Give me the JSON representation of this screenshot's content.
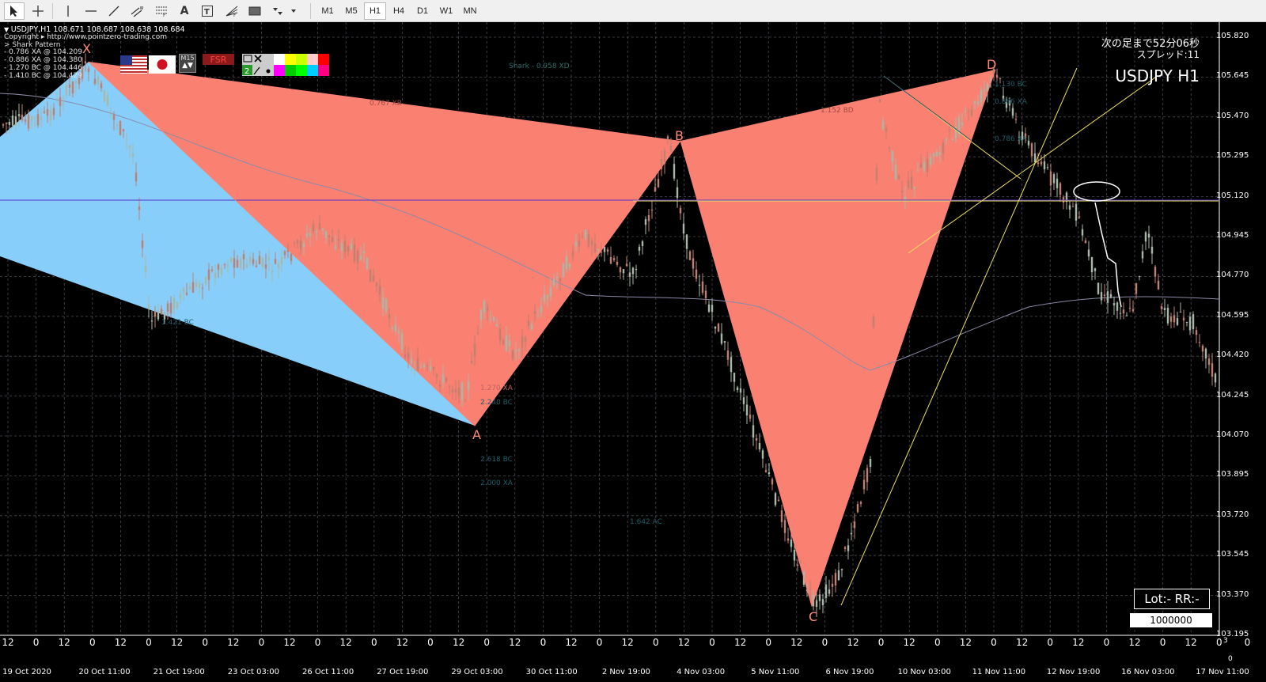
{
  "toolbar": {
    "tools": [
      "cursor-tool",
      "crosshair-tool",
      "vertical-line-tool",
      "horizontal-line-tool",
      "trendline-tool",
      "equidistant-channel-tool",
      "fibonacci-tool",
      "text-tool",
      "text-label-tool",
      "fibonacci-fan-tool",
      "rectangle-tool",
      "arrows-tool"
    ],
    "timeframes": [
      "M1",
      "M5",
      "H1",
      "H4",
      "D1",
      "W1",
      "MN"
    ],
    "active_timeframe": "H1"
  },
  "chart_header": {
    "symbol_line": "USDJPY,H1  108.671 108.687 108.638 108.684",
    "copyright": "Copyright ▸ http://www.pointzero-trading.com",
    "pattern_name": "> Shark Pattern",
    "levels": [
      "- 0.786 XA @ 104.209",
      "- 0.886 XA @ 104.380",
      "- 1.270 BC @ 104.446",
      "- 1.410 BC @ 104.429"
    ]
  },
  "top_right": {
    "next_bar": "次の足まで52分06秒",
    "spread": "スプレッド:11",
    "title": "USDJPY H1"
  },
  "panel": {
    "fsr_label": "FSR",
    "m_label": "M15",
    "two_label": "2"
  },
  "fib_labels": [
    {
      "text": "Shark - 0.958 XD"
    },
    {
      "text": "0.767 XB"
    },
    {
      "text": "1.152 BD"
    },
    {
      "text": "1.130 BC"
    },
    {
      "text": "0.886 XA"
    },
    {
      "text": "0.786 XA"
    },
    {
      "text": "1.421 BC"
    },
    {
      "text": "1.270 XA"
    },
    {
      "text": "2.240 BC"
    },
    {
      "text": "2.618 BC"
    },
    {
      "text": "2.000 XA"
    },
    {
      "text": "1.642 AC"
    }
  ],
  "points": {
    "X": "X",
    "A": "A",
    "B": "B",
    "C": "C",
    "D": "D"
  },
  "lot": {
    "label": "Lot:- RR:-",
    "value": "1000000"
  },
  "y_axis": [
    "105.820",
    "105.645",
    "105.470",
    "105.295",
    "105.120",
    "104.945",
    "104.770",
    "104.595",
    "104.420",
    "104.245",
    "104.070",
    "103.895",
    "103.720",
    "103.545",
    "103.370",
    "103.195"
  ],
  "x_axis_top": [
    "12",
    "0",
    "12",
    "0",
    "12",
    "0",
    "12",
    "0",
    "12",
    "0",
    "12",
    "0",
    "12",
    "0",
    "12",
    "0",
    "12",
    "0",
    "12",
    "0",
    "12",
    "0",
    "12",
    "0",
    "12",
    "0",
    "12",
    "0",
    "12",
    "0",
    "12",
    "0",
    "12",
    "0",
    "12",
    "0",
    "12",
    "0",
    "12",
    "0",
    "12",
    "0",
    "12",
    "0",
    "0"
  ],
  "x_axis_dates": [
    "19 Oct 2020",
    "20 Oct 11:00",
    "21 Oct 19:00",
    "23 Oct 03:00",
    "26 Oct 11:00",
    "27 Oct 19:00",
    "29 Oct 03:00",
    "30 Oct 11:00",
    "2 Nov 19:00",
    "4 Nov 03:00",
    "5 Nov 11:00",
    "6 Nov 19:00",
    "10 Nov 03:00",
    "11 Nov 11:00",
    "12 Nov 19:00",
    "16 Nov 03:00",
    "17 Nov 11:00"
  ],
  "axis_corner": [
    "3",
    "0"
  ],
  "colors": {
    "background": "#000000",
    "pattern_fill": "#fa8072",
    "prior_fill": "#87cefa",
    "grid": "#4a4a55",
    "level_line": "#f0e060",
    "support_line": "#5533cc",
    "candle_up": "#a8b8a8",
    "candle_down": "#c08070",
    "ma": "#8a8aa8"
  }
}
